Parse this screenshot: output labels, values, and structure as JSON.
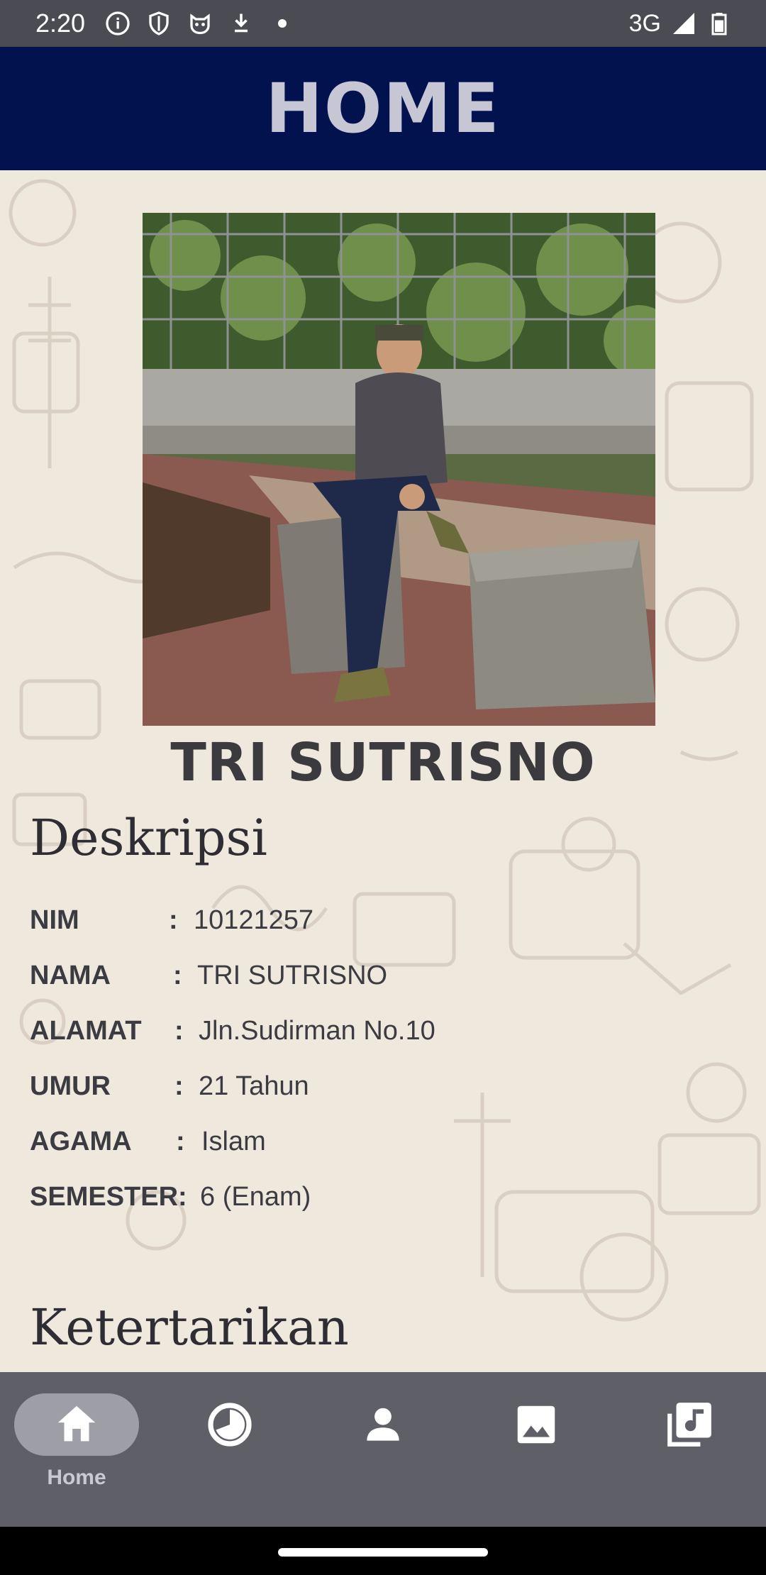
{
  "status_bar": {
    "time": "2:20",
    "network": "3G",
    "icons": [
      "info-icon",
      "shield-icon",
      "cat-face-icon",
      "download-icon",
      "dot-icon"
    ],
    "right_icons": [
      "signal-icon",
      "battery-icon"
    ]
  },
  "app_bar": {
    "title": "HOME"
  },
  "profile": {
    "photo_description": "photo-of-person-sitting-on-stone-block",
    "name": "TRI SUTRISNO"
  },
  "description": {
    "title": "Deskripsi",
    "rows": [
      {
        "label": "NIM",
        "colon": ":",
        "value": "10121257"
      },
      {
        "label": "NAMA",
        "colon": ":",
        "value": "TRI SUTRISNO"
      },
      {
        "label": "ALAMAT",
        "colon": ":",
        "value": "Jln.Sudirman No.10"
      },
      {
        "label": "UMUR",
        "colon": ":",
        "value": "21 Tahun"
      },
      {
        "label": "AGAMA",
        "colon": ":",
        "value": "Islam"
      },
      {
        "label": "SEMESTER:",
        "colon": "",
        "value": "6 (Enam)"
      }
    ]
  },
  "interests": {
    "title": "Ketertarikan"
  },
  "bottom_nav": {
    "items": [
      {
        "icon": "home-icon",
        "label": "Home",
        "active": true
      },
      {
        "icon": "history-icon",
        "label": "",
        "active": false
      },
      {
        "icon": "person-icon",
        "label": "",
        "active": false
      },
      {
        "icon": "image-icon",
        "label": "",
        "active": false
      },
      {
        "icon": "music-library-icon",
        "label": "",
        "active": false
      }
    ]
  },
  "colors": {
    "status_bar": "#4a4b53",
    "app_bar": "#02124f",
    "title_text": "#c7c6d4",
    "background": "#efe8dc",
    "nav_bar": "#5e5f67",
    "nav_active_pill": "#9e9fa6"
  }
}
